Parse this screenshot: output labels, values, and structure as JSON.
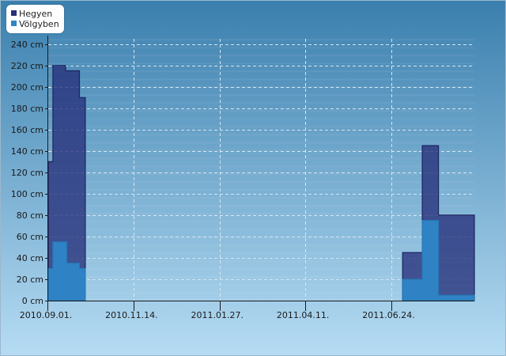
{
  "chart_data": {
    "type": "area",
    "title": "",
    "xlabel": "",
    "ylabel": "",
    "ylim": [
      0,
      245
    ],
    "y_ticks": [
      "0 cm",
      "20 cm",
      "40 cm",
      "60 cm",
      "80 cm",
      "100 cm",
      "120 cm",
      "140 cm",
      "160 cm",
      "180 cm",
      "200 cm",
      "220 cm",
      "240 cm"
    ],
    "y_tick_values": [
      0,
      20,
      40,
      60,
      80,
      100,
      120,
      140,
      160,
      180,
      200,
      220,
      240
    ],
    "x_ticks": [
      "2010.09.01.",
      "2010.11.14.",
      "2011.01.27.",
      "2011.04.11.",
      "2011.06.24."
    ],
    "x_tick_dates": [
      "2010-09-01",
      "2010-11-14",
      "2011-01-27",
      "2011-04-11",
      "2011-06-24"
    ],
    "xlim": [
      "2010-09-01",
      "2011-09-04"
    ],
    "grid": true,
    "legend_position": "top-left",
    "colors": {
      "hegyen": "#26307a",
      "volgyben": "#2e86c8",
      "background_top": "#3a7fae",
      "background_bottom": "#b6dcf3"
    },
    "series": [
      {
        "name": "Hegyen",
        "points": [
          [
            "2010-09-01",
            0
          ],
          [
            "2010-09-01",
            130
          ],
          [
            "2010-09-05",
            130
          ],
          [
            "2010-09-05",
            220
          ],
          [
            "2010-09-16",
            220
          ],
          [
            "2010-09-16",
            215
          ],
          [
            "2010-09-28",
            215
          ],
          [
            "2010-09-28",
            190
          ],
          [
            "2010-10-03",
            190
          ],
          [
            "2010-10-03",
            0
          ],
          [
            "2011-07-04",
            0
          ],
          [
            "2011-07-04",
            45
          ],
          [
            "2011-07-21",
            45
          ],
          [
            "2011-07-21",
            145
          ],
          [
            "2011-08-04",
            145
          ],
          [
            "2011-08-04",
            80
          ],
          [
            "2011-09-04",
            80
          ],
          [
            "2011-09-04",
            0
          ]
        ]
      },
      {
        "name": "Völgyben",
        "points": [
          [
            "2010-09-01",
            0
          ],
          [
            "2010-09-01",
            30
          ],
          [
            "2010-09-05",
            30
          ],
          [
            "2010-09-05",
            55
          ],
          [
            "2010-09-17",
            55
          ],
          [
            "2010-09-17",
            35
          ],
          [
            "2010-09-28",
            35
          ],
          [
            "2010-09-28",
            30
          ],
          [
            "2010-10-03",
            30
          ],
          [
            "2010-10-03",
            0
          ],
          [
            "2011-07-04",
            0
          ],
          [
            "2011-07-04",
            20
          ],
          [
            "2011-07-21",
            20
          ],
          [
            "2011-07-21",
            75
          ],
          [
            "2011-08-04",
            75
          ],
          [
            "2011-08-04",
            5
          ],
          [
            "2011-09-04",
            5
          ],
          [
            "2011-09-04",
            0
          ]
        ]
      }
    ]
  }
}
